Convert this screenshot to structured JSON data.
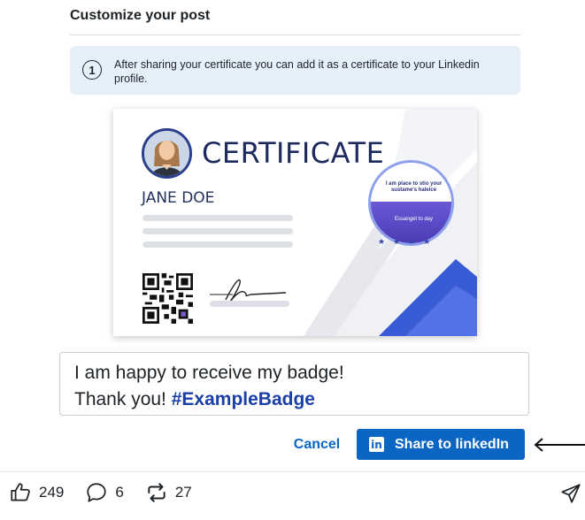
{
  "header": {
    "title": "Customize your post"
  },
  "info": {
    "icon": "info-icon",
    "number_glyph": "1",
    "text": "After sharing your certificate you can add it as a certificate to your Linkedin profile."
  },
  "certificate": {
    "title": "CERTIFICATE",
    "name": "JANE DOE",
    "badge_top_text": "I am place to stio your sustame's haleice",
    "badge_bottom_text": "Essanget to day",
    "accent_color": "#1c2a5e",
    "ribbon_color": "#3a5bd6"
  },
  "message": {
    "line1": "I am happy to receive my badge!",
    "line2_prefix": "Thank you! ",
    "hashtag": "#ExampleBadge"
  },
  "buttons": {
    "cancel_label": "Cancel",
    "share_label": "Share to linkedIn",
    "share_icon_text": "in",
    "primary_color": "#0a66c2"
  },
  "social": {
    "likes": "249",
    "comments": "6",
    "reposts": "27"
  }
}
